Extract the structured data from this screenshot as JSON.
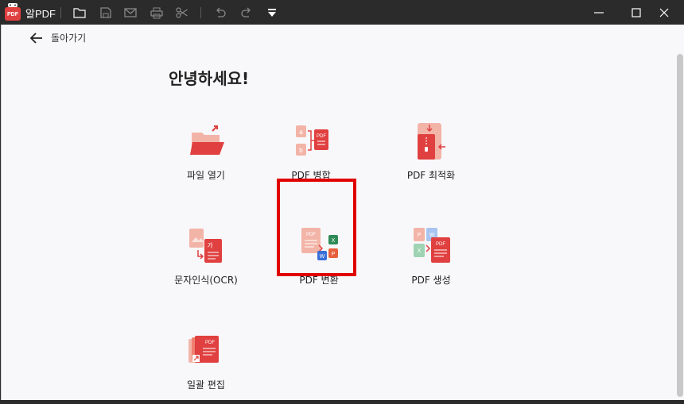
{
  "app": {
    "title": "알PDF"
  },
  "toolbar": {
    "icons": [
      "folder-icon",
      "save-icon",
      "mail-icon",
      "print-icon",
      "scissors-icon",
      "undo-icon",
      "redo-icon",
      "dropdown-arrow-icon"
    ]
  },
  "window": {
    "minimize": "minimize-icon",
    "maximize": "maximize-icon",
    "close": "close-icon"
  },
  "back": {
    "label": "돌아가기"
  },
  "greeting": "안녕하세요!",
  "tiles": [
    {
      "label": "파일 열기",
      "icon": "open-file-icon"
    },
    {
      "label": "PDF 병합",
      "icon": "merge-pdf-icon"
    },
    {
      "label": "PDF 최적화",
      "icon": "optimize-pdf-icon"
    },
    {
      "label": "문자인식(OCR)",
      "icon": "ocr-icon"
    },
    {
      "label": "PDF 변환",
      "icon": "convert-pdf-icon",
      "highlighted": true
    },
    {
      "label": "PDF 생성",
      "icon": "create-pdf-icon"
    },
    {
      "label": "일괄 편집",
      "icon": "batch-edit-icon"
    }
  ],
  "colors": {
    "accent": "#e0403f",
    "highlight": "#e00000",
    "titlebar": "#2b2b2b",
    "background": "#f8f8fa"
  }
}
